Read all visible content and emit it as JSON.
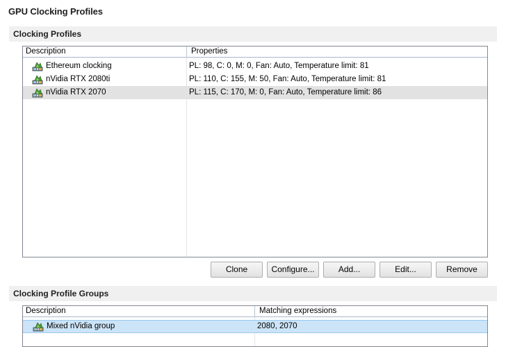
{
  "page": {
    "title": "GPU Clocking Profiles"
  },
  "profiles_section": {
    "header": "Clocking Profiles",
    "columns": [
      "Description",
      "Properties"
    ],
    "rows": [
      {
        "description": "Ethereum clocking",
        "properties": "PL: 98, C: 0, M: 0, Fan: Auto, Temperature limit: 81",
        "icon": "gpu-card-icon"
      },
      {
        "description": "nVidia RTX 2080ti",
        "properties": "PL: 110, C: 155, M: 50, Fan: Auto, Temperature limit: 81",
        "icon": "gpu-card-icon"
      },
      {
        "description": "nVidia RTX 2070",
        "properties": "PL: 115, C: 170, M: 0, Fan: Auto, Temperature limit: 86",
        "icon": "gpu-card-icon",
        "selected": true
      }
    ],
    "buttons": {
      "clone": "Clone",
      "configure": "Configure...",
      "add": "Add...",
      "edit": "Edit...",
      "remove": "Remove"
    }
  },
  "groups_section": {
    "header": "Clocking Profile Groups",
    "columns": [
      "Description",
      "Matching expressions"
    ],
    "rows": [
      {
        "description": "Mixed nVidia group",
        "expressions": "2080, 2070",
        "icon": "gpu-group-icon",
        "selected": true
      }
    ]
  },
  "colors": {
    "selected_row_gray": "#e2e2e2",
    "selected_row_blue": "#cce4f7",
    "section_header_bg": "#f0f0f0"
  }
}
